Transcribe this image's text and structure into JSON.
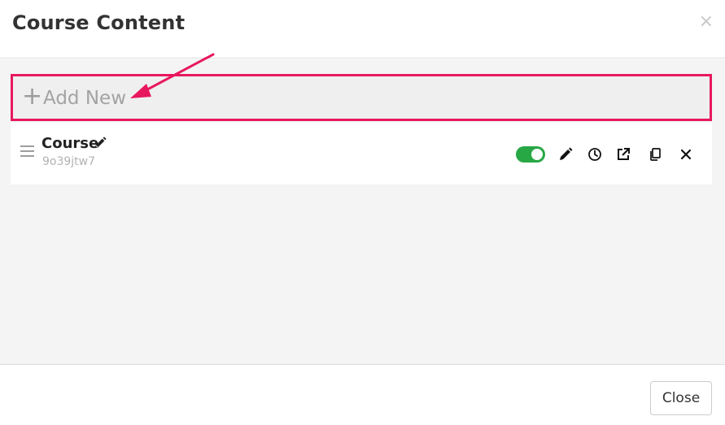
{
  "header": {
    "title": "Course Content",
    "close_symbol": "×"
  },
  "add_new": {
    "plus_symbol": "+",
    "label": "Add New"
  },
  "items": [
    {
      "title": "Course",
      "id": "9o39jtw7",
      "enabled": true,
      "actions": [
        "pencil-icon",
        "clock-icon",
        "external-link-icon",
        "copy-icon",
        "close-icon"
      ]
    }
  ],
  "footer": {
    "close_label": "Close"
  },
  "colors": {
    "highlight_border": "#e8185f",
    "arrow": "#e8185f",
    "toggle_on": "#28a745"
  }
}
